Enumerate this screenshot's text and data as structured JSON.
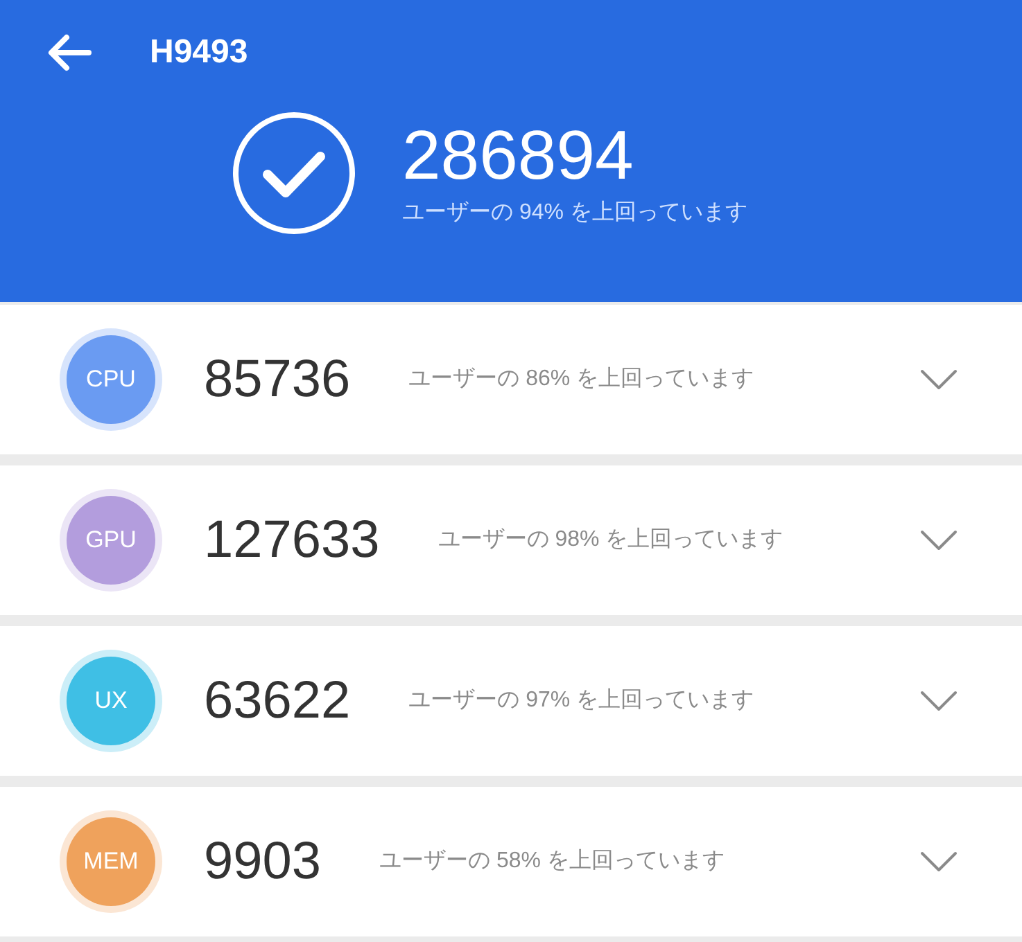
{
  "header": {
    "title": "H9493",
    "score": "286894",
    "subtitle": "ユーザーの 94% を上回っています"
  },
  "categories": [
    {
      "label": "CPU",
      "color": "#6a9bf2",
      "score": "85736",
      "subtitle": "ユーザーの 86% を上回っています",
      "expanded": false
    },
    {
      "label": "GPU",
      "color": "#b39ddd",
      "score": "127633",
      "subtitle": "ユーザーの 98% を上回っています",
      "expanded": false
    },
    {
      "label": "UX",
      "color": "#3fbfe5",
      "score": "63622",
      "subtitle": "ユーザーの 97% を上回っています",
      "expanded": false
    },
    {
      "label": "MEM",
      "color": "#efa25c",
      "score": "9903",
      "subtitle": "ユーザーの 58% を上回っています",
      "expanded": false
    }
  ]
}
